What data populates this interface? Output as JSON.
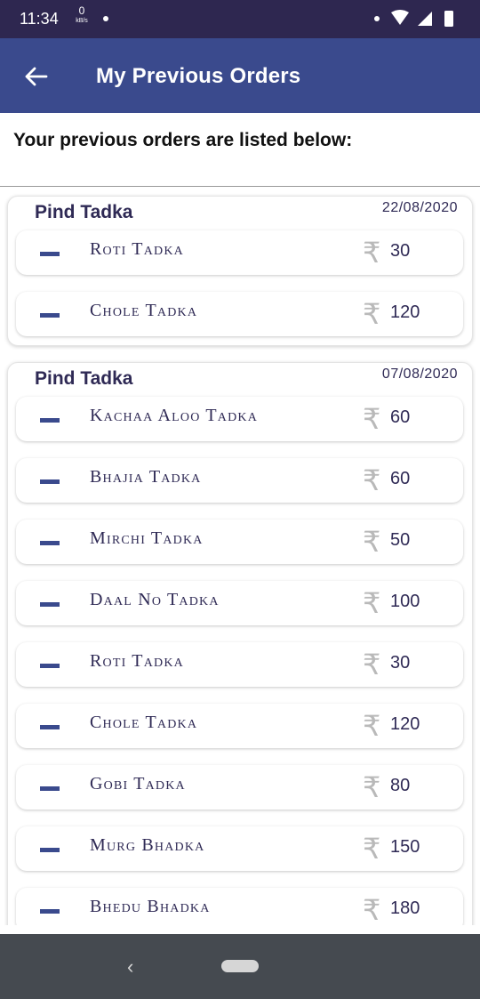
{
  "status_bar": {
    "time": "11:34",
    "net_speed": "0",
    "net_unit": "kB/s",
    "icons": [
      "dot-icon",
      "wifi-icon",
      "cell-signal-icon",
      "battery-icon"
    ]
  },
  "app_bar": {
    "title": "My Previous Orders",
    "back_icon": "arrow-left-icon",
    "color": "#3a4a8d"
  },
  "subtitle": "Your previous orders are listed below:",
  "currency_symbol": "₹",
  "orders": [
    {
      "shop": "Pind Tadka",
      "date": "22/08/2020",
      "items": [
        {
          "name": "Roti Tadka",
          "price": "30"
        },
        {
          "name": "Chole Tadka",
          "price": "120"
        }
      ]
    },
    {
      "shop": "Pind Tadka",
      "date": "07/08/2020",
      "items": [
        {
          "name": "Kachaa Aloo Tadka",
          "price": "60"
        },
        {
          "name": "Bhajia Tadka",
          "price": "60"
        },
        {
          "name": "Mirchi Tadka",
          "price": "50"
        },
        {
          "name": "Daal No Tadka",
          "price": "100"
        },
        {
          "name": "Roti Tadka",
          "price": "30"
        },
        {
          "name": "Chole Tadka",
          "price": "120"
        },
        {
          "name": "Gobi Tadka",
          "price": "80"
        },
        {
          "name": "Murg Bhadka",
          "price": "150"
        },
        {
          "name": "Bhedu Bhadka",
          "price": "180"
        }
      ]
    }
  ],
  "nav_bar": {
    "back_icon": "nav-back-icon",
    "home_icon": "nav-home-pill-icon"
  }
}
